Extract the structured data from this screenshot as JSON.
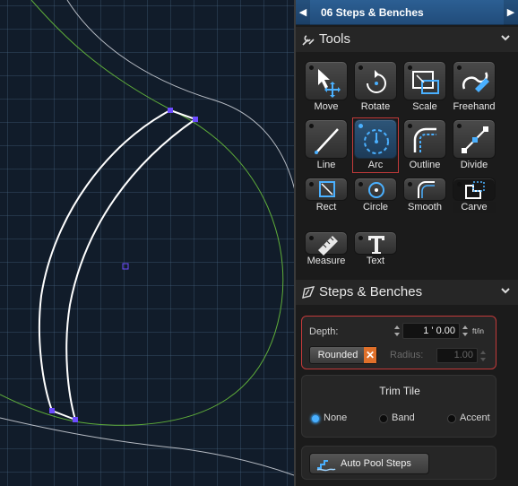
{
  "panel": {
    "title": "06 Steps & Benches",
    "nav_left_icon": "chevron-left-icon",
    "nav_right_icon": "chevron-right-icon"
  },
  "tools": {
    "header": "Tools",
    "items": [
      {
        "label": "Move",
        "icon": "move-icon"
      },
      {
        "label": "Rotate",
        "icon": "rotate-icon"
      },
      {
        "label": "Scale",
        "icon": "scale-icon"
      },
      {
        "label": "Freehand",
        "icon": "freehand-icon"
      },
      {
        "label": "Line",
        "icon": "line-icon"
      },
      {
        "label": "Arc",
        "icon": "arc-icon"
      },
      {
        "label": "Outline",
        "icon": "outline-icon"
      },
      {
        "label": "Divide",
        "icon": "divide-icon"
      },
      {
        "label": "Rect",
        "icon": "rect-icon"
      },
      {
        "label": "Circle",
        "icon": "circle-icon"
      },
      {
        "label": "Smooth",
        "icon": "smooth-icon"
      },
      {
        "label": "Carve",
        "icon": "carve-icon"
      },
      {
        "label": "Measure",
        "icon": "measure-icon"
      },
      {
        "label": "Text",
        "icon": "text-icon"
      }
    ],
    "active": "Arc",
    "accent": "#4ab0ff",
    "highlight": "#c23a3a"
  },
  "steps": {
    "header": "Steps & Benches",
    "depth_label": "Depth:",
    "depth_value": "1 ' 0.00",
    "depth_unit": "ft/in",
    "rounded_label": "Rounded",
    "radius_label": "Radius:",
    "radius_value": "1.00",
    "trim_title": "Trim Tile",
    "trim_options": [
      "None",
      "Band",
      "Accent"
    ],
    "trim_selected": "None",
    "auto_button": "Auto Pool Steps"
  }
}
